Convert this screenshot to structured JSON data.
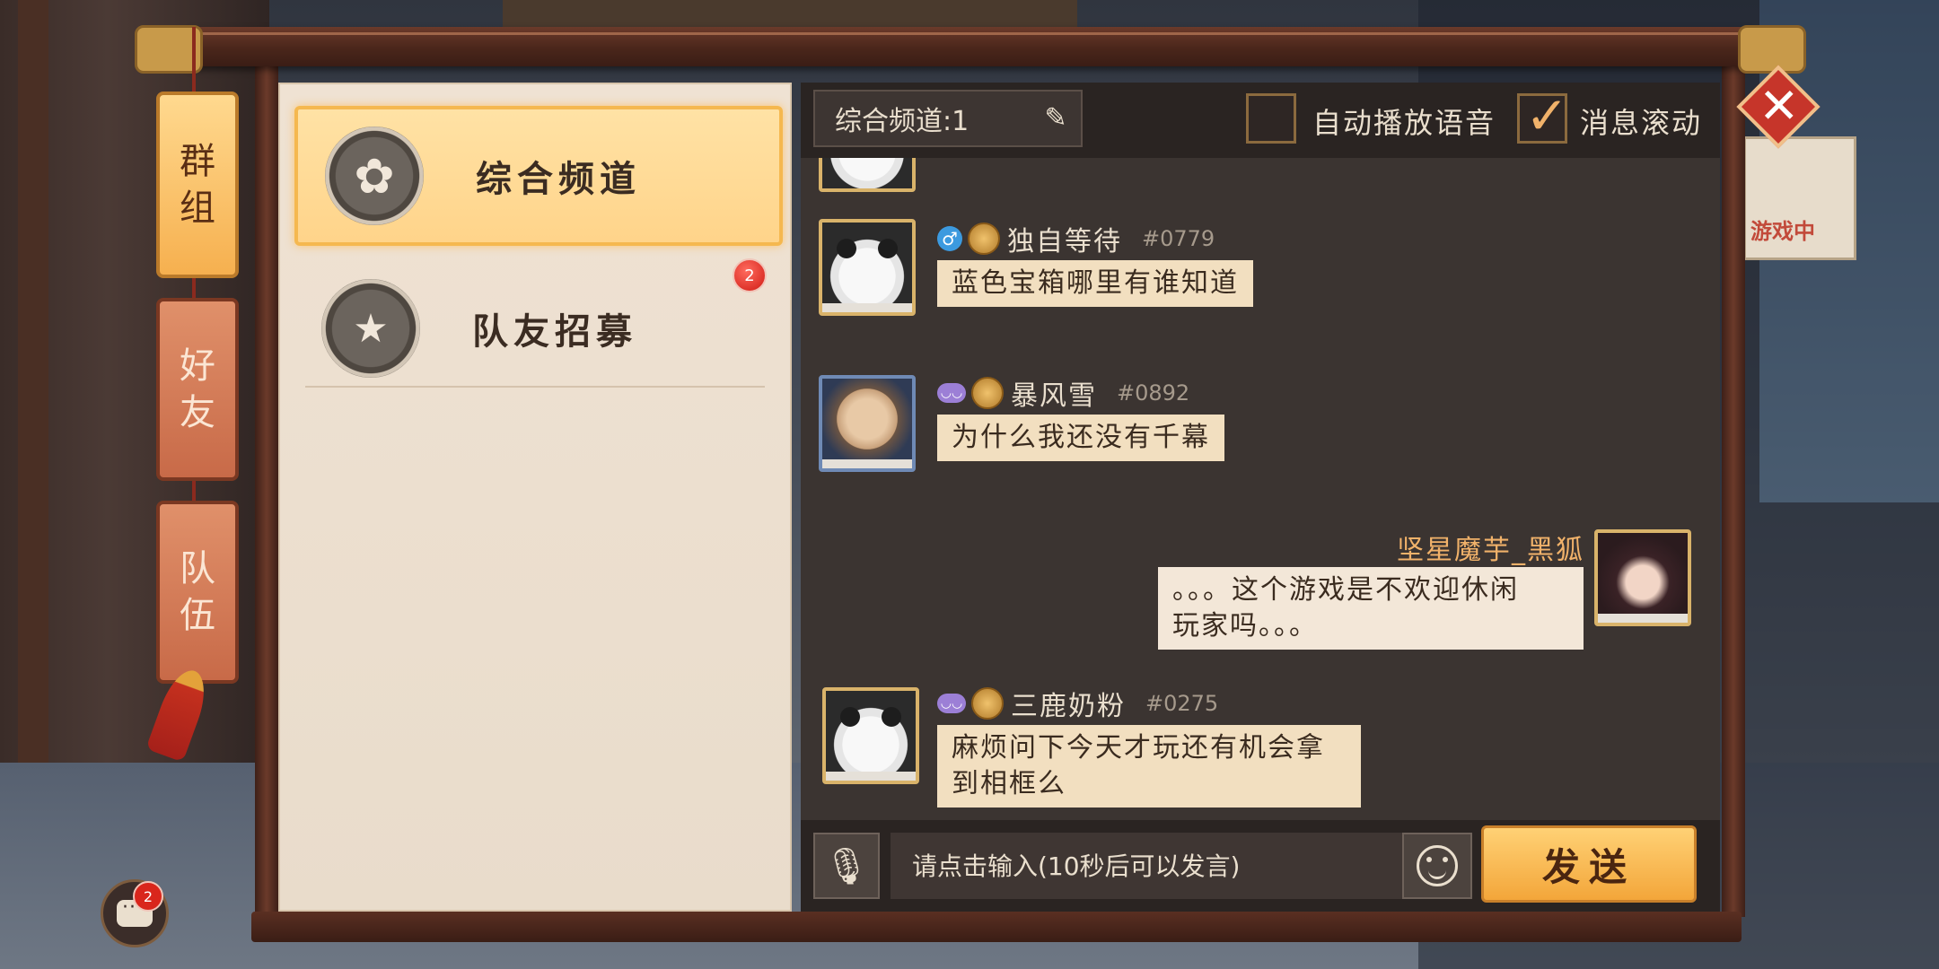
{
  "side_tabs": [
    {
      "label": "群\n组",
      "active": true
    },
    {
      "label": "好\n友",
      "active": false
    },
    {
      "label": "队\n伍",
      "active": false
    }
  ],
  "background": {
    "badge_text": "游戏中"
  },
  "channels": [
    {
      "label": "综合频道",
      "icon": "flower-icon",
      "active": true
    },
    {
      "label": "队友招募",
      "icon": "recruit-flag-icon",
      "active": false,
      "badge": "2"
    }
  ],
  "chat": {
    "channel_select": "综合频道:1",
    "options": [
      {
        "label": "自动播放语音",
        "checked": false
      },
      {
        "label": "消息滚动",
        "checked": true
      }
    ],
    "messages": [
      {
        "name": "独自等待",
        "id": "#0779",
        "text": "蓝色宝箱哪里有谁知道",
        "avatar": "panda",
        "side": "left"
      },
      {
        "name": "暴风雪",
        "id": "#0892",
        "text": "为什么我还没有千幕",
        "avatar": "bald",
        "side": "left"
      },
      {
        "name": "坚星魔芋_黑狐",
        "text_line1": "。。。这个游戏是不欢迎休闲",
        "text_line2": "玩家吗。。。",
        "avatar": "girl",
        "side": "right"
      },
      {
        "name": "三鹿奶粉",
        "id": "#0275",
        "text_line1": "麻烦问下今天才玩还有机会拿",
        "text_line2": "到相框么",
        "avatar": "panda",
        "side": "left"
      }
    ],
    "input_placeholder": "请点击输入(10秒后可以发言)",
    "send_label": "发送"
  },
  "chat_fab": {
    "badge": "2"
  },
  "colors": {
    "accent": "#f3a63a",
    "panel": "#3b3431",
    "bubble": "#f2dfc0",
    "badge": "#d01b14"
  }
}
